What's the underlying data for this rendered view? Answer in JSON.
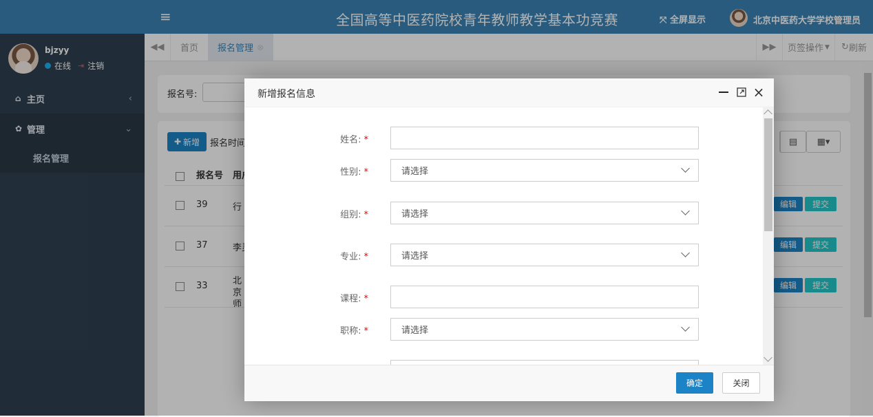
{
  "header": {
    "menu_icon": "hamburger-icon",
    "title": "全国高等中医药院校青年教师教学基本功竞赛",
    "fullscreen_label": "全屏显示",
    "admin_name": "北京中医药大学学校管理员"
  },
  "sidebar": {
    "username": "bjzyy",
    "status_online": "在线",
    "logout": "注销",
    "items": [
      {
        "label": "主页",
        "icon": "home-icon"
      },
      {
        "label": "管理",
        "icon": "gear-icon"
      }
    ],
    "sub_item": "报名管理"
  },
  "tabs": {
    "items": [
      {
        "label": "首页"
      },
      {
        "label": "报名管理"
      }
    ],
    "ops_label": "页签操作",
    "refresh_label": "刷新"
  },
  "background": {
    "search_label": "报名号:",
    "add_label": "新增",
    "date_label": "报名时间",
    "columns": [
      "报名号",
      "用户"
    ],
    "rows": [
      {
        "id": "39",
        "name": "行"
      },
      {
        "id": "37",
        "name": "李灵"
      },
      {
        "id": "33",
        "name": "北京 师"
      }
    ],
    "edit_label": "编辑",
    "submit_label": "提交"
  },
  "modal": {
    "title": "新增报名信息",
    "fields": [
      {
        "label": "姓名:",
        "type": "text",
        "value": ""
      },
      {
        "label": "性别:",
        "type": "select",
        "value": "请选择"
      },
      {
        "label": "组别:",
        "type": "select",
        "value": "请选择"
      },
      {
        "label": "专业:",
        "type": "select",
        "value": "请选择"
      },
      {
        "label": "课程:",
        "type": "text",
        "value": ""
      },
      {
        "label": "职称:",
        "type": "select",
        "value": "请选择"
      }
    ],
    "required_mark": "*",
    "confirm_label": "确定",
    "close_label": "关闭"
  },
  "colors": {
    "brand": "#3a83b4",
    "sidebar": "#2f4050",
    "primary_button": "#1c84c6",
    "info_button": "#23c6c8",
    "required": "#e00000"
  }
}
